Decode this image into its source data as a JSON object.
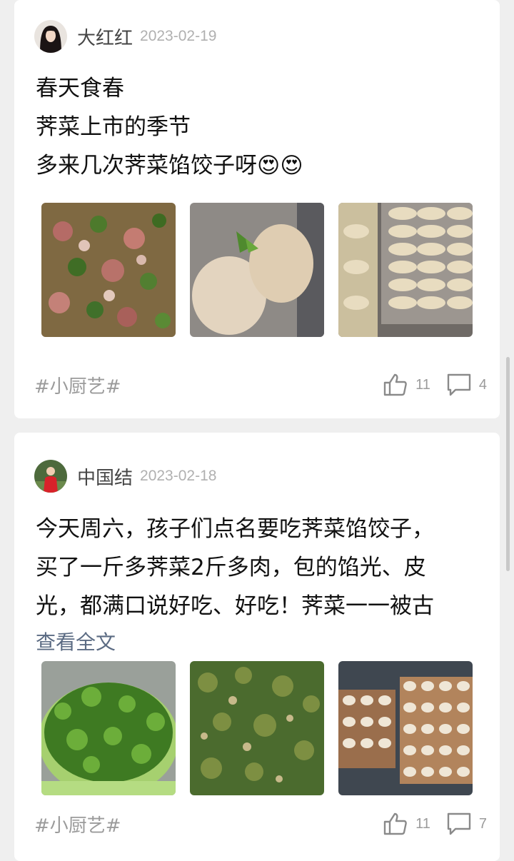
{
  "posts": [
    {
      "author": "大红红",
      "date": "2023-02-19",
      "lines": [
        "春天食春",
        "荠菜上市的季节",
        "多来几次荠菜馅饺子呀"
      ],
      "emoji": "😍😍",
      "tag": "#小厨艺#",
      "likes": "11",
      "comments": "4",
      "images": [
        "raw-filling-photo",
        "flour-bags-photo",
        "dumpling-trays-photo"
      ]
    },
    {
      "author": "中国结",
      "date": "2023-02-18",
      "lines": [
        "今天周六，孩子们点名要吃荠菜馅饺子，",
        "买了一斤多荠菜2斤多肉，包的馅光、皮",
        "光，都满口说好吃、好吃！荠菜一一被古"
      ],
      "more": "查看全文",
      "tag": "#小厨艺#",
      "likes": "11",
      "comments": "7",
      "images": [
        "shepherds-purse-basin-photo",
        "chopped-greens-photo",
        "dumplings-board-photo"
      ]
    }
  ],
  "colors": {
    "background": "#efefef",
    "card": "#ffffff",
    "text": "#111111",
    "meta": "#b0b0b0",
    "link": "#5b6b83"
  },
  "icons": [
    "thumbs-up-icon",
    "comment-icon"
  ]
}
